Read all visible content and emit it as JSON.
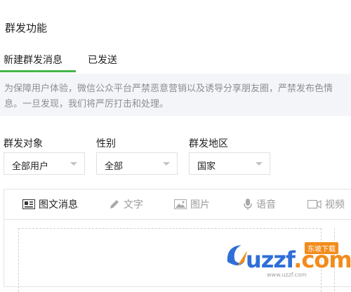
{
  "page": {
    "title": "群发功能"
  },
  "tabs": [
    {
      "label": "新建群发消息",
      "active": true
    },
    {
      "label": "已发送",
      "active": false
    }
  ],
  "notice": {
    "line1": "为保障用户体验，微信公众平台严禁恶意营销以及诱导分享朋友圈，严禁发布色情",
    "line2": "息。一旦发现，我们将严厉打击和处理。"
  },
  "filters": {
    "target": {
      "label": "群发对象",
      "value": "全部用户"
    },
    "gender": {
      "label": "性别",
      "value": "全部"
    },
    "region": {
      "label": "群发地区",
      "value": "国家"
    }
  },
  "toolbar": {
    "items": [
      {
        "label": "图文消息",
        "icon": "news-icon",
        "active": true
      },
      {
        "label": "文字",
        "icon": "pencil-icon",
        "active": false
      },
      {
        "label": "图片",
        "icon": "image-icon",
        "active": false
      },
      {
        "label": "语音",
        "icon": "microphone-icon",
        "active": false
      },
      {
        "label": "视频",
        "icon": "video-icon",
        "active": false
      }
    ]
  },
  "watermark": {
    "brand": "uzzf",
    "suffix": ".com",
    "badge": "东坡下载",
    "url": "www.uzzf.com"
  },
  "colors": {
    "accent": "#44b549",
    "notice_bg": "#f4f5f9",
    "watermark_blue": "#2e6fd8",
    "watermark_orange": "#f28c1c"
  }
}
